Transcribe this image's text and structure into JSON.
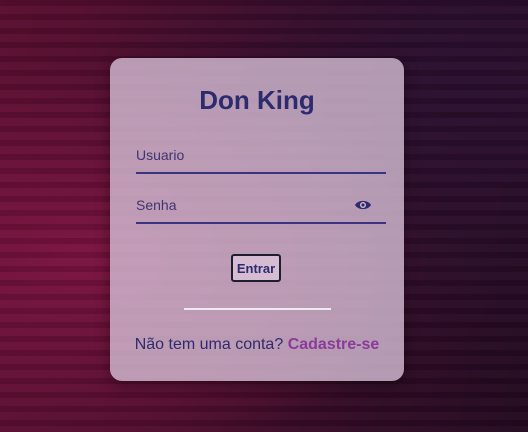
{
  "login_card": {
    "title": "Don King",
    "username_field": {
      "placeholder": "Usuario",
      "value": ""
    },
    "password_field": {
      "placeholder": "Senha",
      "value": "",
      "toggle_icon": "eye-icon"
    },
    "submit_label": "Entrar",
    "signup_prompt": "Não tem uma conta?",
    "signup_link": "Cadastre-se"
  },
  "colors": {
    "title": "#2d2a6e",
    "link": "#8a3a9a",
    "card_background": "#d6bed6",
    "page_background": "#4a0c2b"
  }
}
